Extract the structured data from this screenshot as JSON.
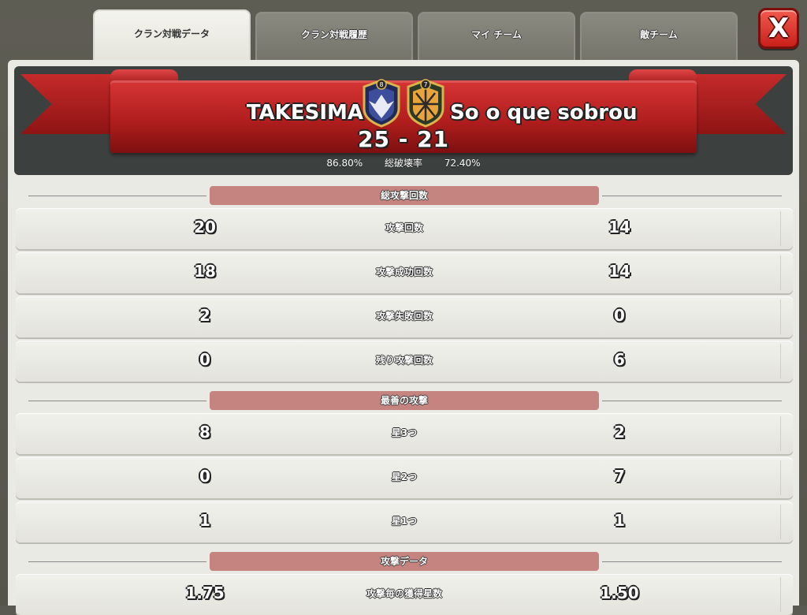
{
  "tabs": [
    {
      "label": "クラン対戦データ",
      "active": true
    },
    {
      "label": "クラン対戦履歴",
      "active": false
    },
    {
      "label": "マイ チーム",
      "active": false
    },
    {
      "label": "敵チーム",
      "active": false
    }
  ],
  "close_label": "X",
  "header": {
    "left_team": "TAKESIMA",
    "right_team": "So o que sobrou",
    "left_badge_level": "8",
    "right_badge_level": "7",
    "score_left": "25",
    "score_sep": "-",
    "score_right": "21",
    "left_destruction": "86.80%",
    "destruction_label": "総破壊率",
    "right_destruction": "72.40%"
  },
  "sections": {
    "attacks": {
      "title": "総攻撃回数",
      "rows": [
        {
          "label": "攻撃回数",
          "left": "20",
          "right": "14"
        },
        {
          "label": "攻撃成功回数",
          "left": "18",
          "right": "14"
        },
        {
          "label": "攻撃失敗回数",
          "left": "2",
          "right": "0"
        },
        {
          "label": "残り攻撃回数",
          "left": "0",
          "right": "6"
        }
      ]
    },
    "best": {
      "title": "最善の攻撃",
      "rows": [
        {
          "label": "星3つ",
          "left": "8",
          "right": "2"
        },
        {
          "label": "星2つ",
          "left": "0",
          "right": "7"
        },
        {
          "label": "星1つ",
          "left": "1",
          "right": "1"
        }
      ]
    },
    "data": {
      "title": "攻撃データ",
      "rows": [
        {
          "label": "攻撃毎の獲得星数",
          "left": "1.75",
          "right": "1.50"
        }
      ]
    }
  },
  "colors": {
    "banner_red": "#b21e1e",
    "section_pill": "#c68481",
    "close_red": "#d8302a"
  }
}
